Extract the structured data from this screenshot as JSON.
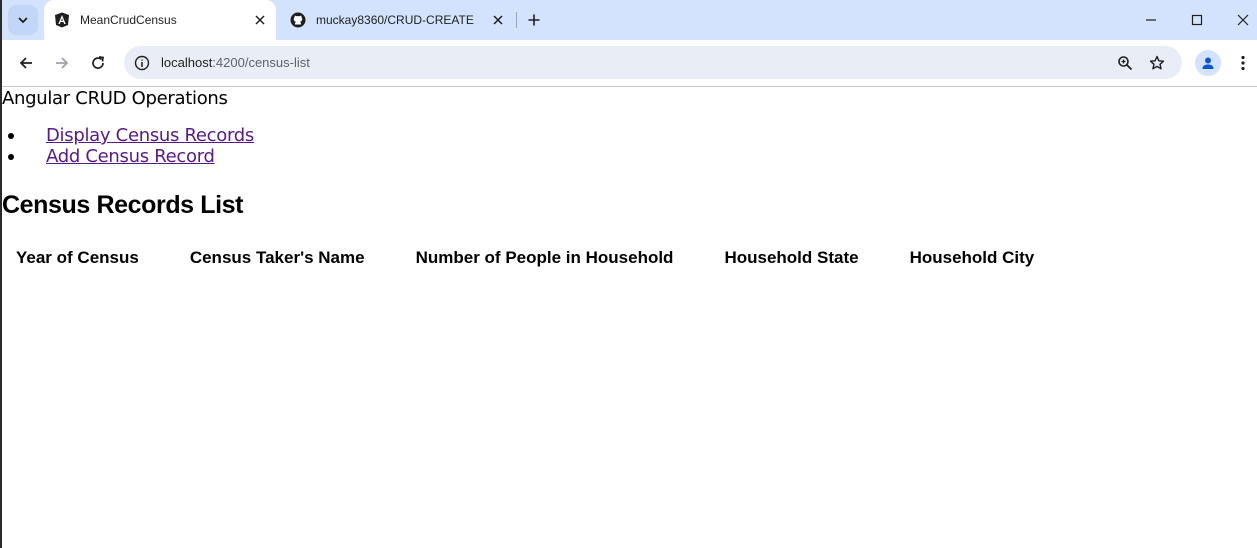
{
  "browser": {
    "tabs": [
      {
        "title": "MeanCrudCensus",
        "favicon": "angular-icon",
        "active": true
      },
      {
        "title": "muckay8360/CRUD-CREATE",
        "favicon": "github-icon",
        "active": false
      }
    ],
    "address": {
      "host": "localhost",
      "path": ":4200/census-list"
    },
    "colors": {
      "tabstrip": "#d3e3fd",
      "omnibox": "#e9eef6",
      "link_visited": "#551a8b"
    }
  },
  "page": {
    "app_title": "Angular CRUD Operations",
    "nav": [
      {
        "label": "Display Census Records"
      },
      {
        "label": "Add Census Record"
      }
    ],
    "heading": "Census Records List",
    "table": {
      "columns": [
        "Year of Census",
        "Census Taker's Name",
        "Number of People in Household",
        "Household State",
        "Household City"
      ],
      "rows": []
    }
  }
}
